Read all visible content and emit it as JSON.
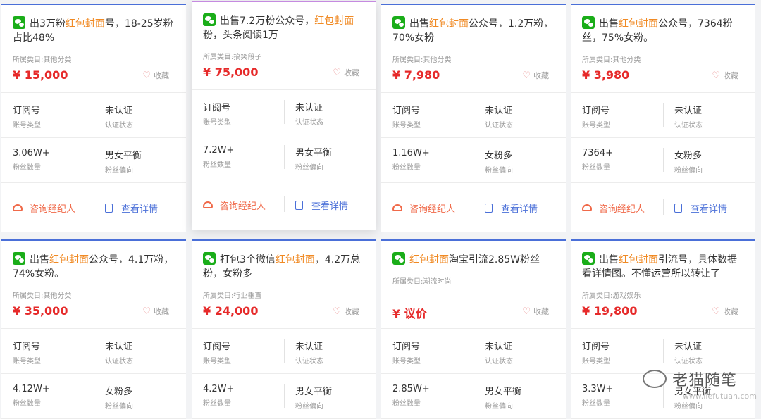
{
  "labels": {
    "category_prefix": "所属类目:",
    "favorite": "收藏",
    "account_type_key": "账号类型",
    "cert_key": "认证状态",
    "fans_key": "粉丝数量",
    "bias_key": "粉丝偏向",
    "consult": "咨询经纪人",
    "detail": "查看详情"
  },
  "cards": [
    {
      "pre": "出3万粉",
      "hl": "红包封面",
      "post": "号，18-25岁粉占比48%",
      "category": "其他分类",
      "price": "¥ 15,000",
      "type": "订阅号",
      "cert": "未认证",
      "fans": "3.06W+",
      "bias": "男女平衡"
    },
    {
      "pre": "出售7.2万粉公众号，",
      "hl": "红包封面",
      "post": "粉，头条阅读1万",
      "category": "搞笑段子",
      "price": "¥ 75,000",
      "type": "订阅号",
      "cert": "未认证",
      "fans": "7.2W+",
      "bias": "男女平衡"
    },
    {
      "pre": "出售",
      "hl": "红包封面",
      "post": "公众号，1.2万粉，70%女粉",
      "category": "其他分类",
      "price": "¥ 7,980",
      "type": "订阅号",
      "cert": "未认证",
      "fans": "1.16W+",
      "bias": "女粉多"
    },
    {
      "pre": "出售",
      "hl": "红包封面",
      "post": "公众号，7364粉丝，75%女粉。",
      "category": "其他分类",
      "price": "¥ 3,980",
      "type": "订阅号",
      "cert": "未认证",
      "fans": "7364+",
      "bias": "女粉多"
    },
    {
      "pre": "出售",
      "hl": "红包封面",
      "post": "公众号，4.1万粉，74%女粉。",
      "category": "其他分类",
      "price": "¥ 35,000",
      "type": "订阅号",
      "cert": "未认证",
      "fans": "4.12W+",
      "bias": "女粉多"
    },
    {
      "pre": "打包3个微信",
      "hl": "红包封面",
      "post": "，4.2万总粉，女粉多",
      "category": "行业垂直",
      "price": "¥ 24,000",
      "type": "订阅号",
      "cert": "未认证",
      "fans": "4.2W+",
      "bias": "男女平衡"
    },
    {
      "pre": "",
      "hl": "红包封面",
      "post": "淘宝引流2.85W粉丝",
      "category": "潮流时尚",
      "price": "¥ 议价",
      "type": "订阅号",
      "cert": "未认证",
      "fans": "2.85W+",
      "bias": "男女平衡"
    },
    {
      "pre": "出售",
      "hl": "红包封面",
      "post": "引流号，具体数据看详情图。不懂运营所以转让了",
      "category": "游戏娱乐",
      "price": "¥ 19,800",
      "type": "订阅号",
      "cert": "未认证",
      "fans": "3.3W+",
      "bias": "男女平衡"
    }
  ],
  "watermark": {
    "name": "老猫随笔",
    "url": "www.liefutuan.com"
  }
}
